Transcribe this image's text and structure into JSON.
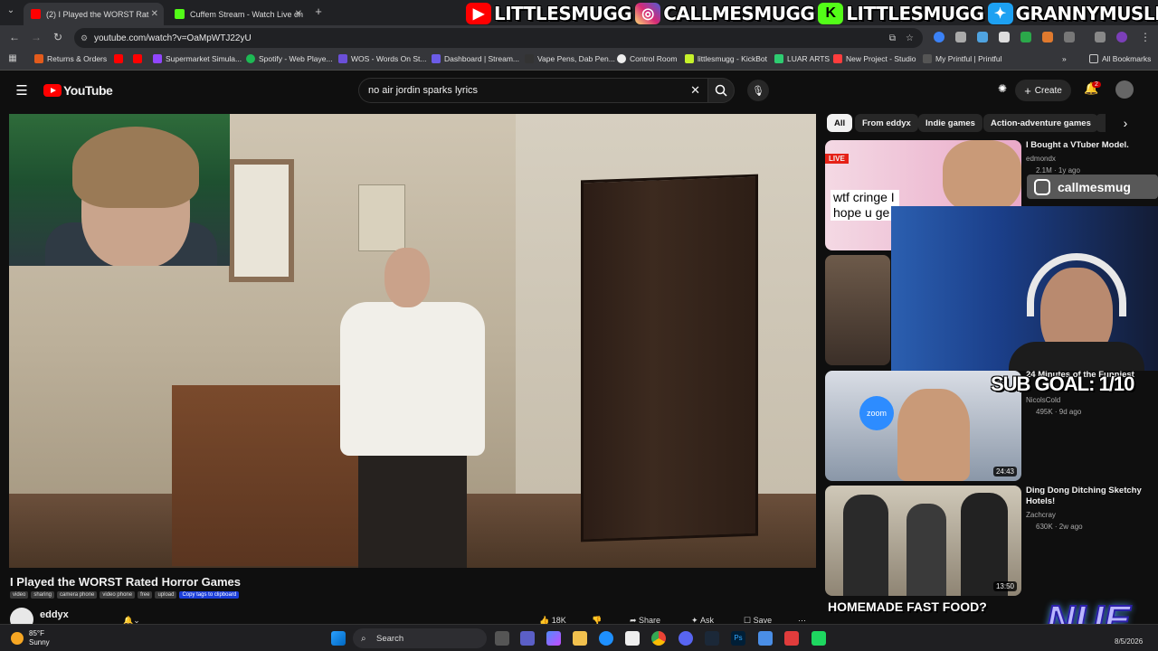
{
  "browser": {
    "tabs": [
      {
        "label": "(2) I Played the WORST Rat",
        "active": true
      },
      {
        "label": "Cuffem Stream - Watch Live on",
        "active": false
      }
    ],
    "url": "youtube.com/watch?v=OaMpWTJ22yU",
    "bookmarks": [
      "Returns & Orders",
      "Supermarket Simula...",
      "Spotify - Web Playe...",
      "WOS - Words On St...",
      "Dashboard | Stream...",
      "Vape Pens, Dab Pen...",
      "Control Room",
      "littlesmugg - KickBot",
      "LUAR ARTS",
      "New Project - Studio",
      "My Printful | Printful"
    ],
    "all_bookmarks": "All Bookmarks"
  },
  "stream_banner": {
    "items": [
      {
        "icon": "youtube-icon",
        "text": "LITTLESMUGG",
        "color": "#ff0000"
      },
      {
        "icon": "instagram-icon",
        "text": "CALLMESMUGG",
        "color": "#d6249f"
      },
      {
        "icon": "kick-icon",
        "text": "LITTLESMUGG",
        "color": "#53fc18"
      },
      {
        "icon": "twitter-icon",
        "text": "GRANNYMUSLIM",
        "color": "#1da1f2"
      }
    ]
  },
  "youtube": {
    "logo": "YouTube",
    "search_query": "no air jordin sparks lyrics",
    "create_label": "Create",
    "notification_count": "2",
    "video_title": "I Played the WORST Rated Horror Games",
    "tags": [
      "video",
      "sharing",
      "camera phone",
      "video phone",
      "free",
      "upload"
    ],
    "copy_tags": "Copy tags to clipboard",
    "channel": "eddyx",
    "actions": {
      "likes": "18K",
      "share": "Share",
      "ask": "Ask",
      "save": "Save"
    }
  },
  "sidebar": {
    "chips": [
      "All",
      "From eddyx",
      "Indie games",
      "Action-adventure games"
    ],
    "videos": [
      {
        "title": "I Bought a VTuber Model.",
        "channel": "edmondx",
        "meta": "2.1M · 1y ago",
        "thumb_text": "wtf cringe I hope u ge",
        "live_badge": "LIVE"
      },
      {
        "title": "24 Minutes of the Funniest",
        "channel": "NicolsCold",
        "meta": "495K · 9d ago",
        "duration": "24:43",
        "thumb_text": "zoom"
      },
      {
        "title": "Ding Dong Ditching Sketchy Hotels!",
        "channel": "Zachcray",
        "meta": "630K · 2w ago",
        "duration": "13:50"
      }
    ],
    "bottom_caption": "HOMEMADE FAST FOOD?"
  },
  "overlays": {
    "instagram_handle": "callmesmug",
    "sub_goal": "SUB GOAL: 1/10",
    "nue_logo": "NUE"
  },
  "taskbar": {
    "weather_temp": "85°F",
    "weather_desc": "Sunny",
    "search_label": "Search",
    "date": "8/5/2026"
  }
}
